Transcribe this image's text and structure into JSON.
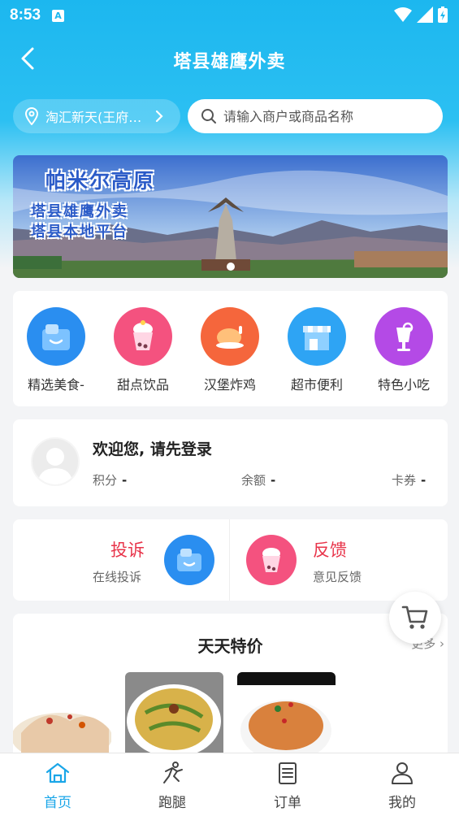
{
  "status_bar": {
    "time": "8:53",
    "indicator": "A"
  },
  "header": {
    "title": "塔县雄鹰外卖"
  },
  "location": {
    "text": "淘汇新天(王府…"
  },
  "search": {
    "placeholder": "请输入商户或商品名称"
  },
  "banner": {
    "title": "帕米尔高原",
    "line1": "塔县雄鹰外卖",
    "line2": "塔县本地平台"
  },
  "categories": [
    {
      "label": "精选美食-",
      "icon": "food-bag-icon",
      "color": "#2a8ef0"
    },
    {
      "label": "甜点饮品",
      "icon": "milk-tea-icon",
      "color": "#f4527f"
    },
    {
      "label": "汉堡炸鸡",
      "icon": "roast-chicken-icon",
      "color": "#f5663c"
    },
    {
      "label": "超市便利",
      "icon": "store-icon",
      "color": "#2ea4f4"
    },
    {
      "label": "特色小吃",
      "icon": "snack-cup-icon",
      "color": "#b44ae6"
    }
  ],
  "welcome": {
    "title": "欢迎您, 请先登录",
    "points_label": "积分",
    "points_value": "-",
    "balance_label": "余额",
    "balance_value": "-",
    "coupons_label": "卡券",
    "coupons_value": "-"
  },
  "services": {
    "complaint_title": "投诉",
    "complaint_sub": "在线投诉",
    "feedback_title": "反馈",
    "feedback_sub": "意见反馈"
  },
  "deals": {
    "title": "天天特价",
    "more_label": "更多"
  },
  "tabbar": [
    {
      "label": "首页",
      "icon": "home-icon",
      "active": true
    },
    {
      "label": "跑腿",
      "icon": "runner-icon",
      "active": false
    },
    {
      "label": "订单",
      "icon": "order-list-icon",
      "active": false
    },
    {
      "label": "我的",
      "icon": "profile-icon",
      "active": false
    }
  ],
  "colors": {
    "header_blue": "#1cb7ef",
    "accent_red": "#e8344a",
    "active_tab": "#1aa6e8"
  }
}
